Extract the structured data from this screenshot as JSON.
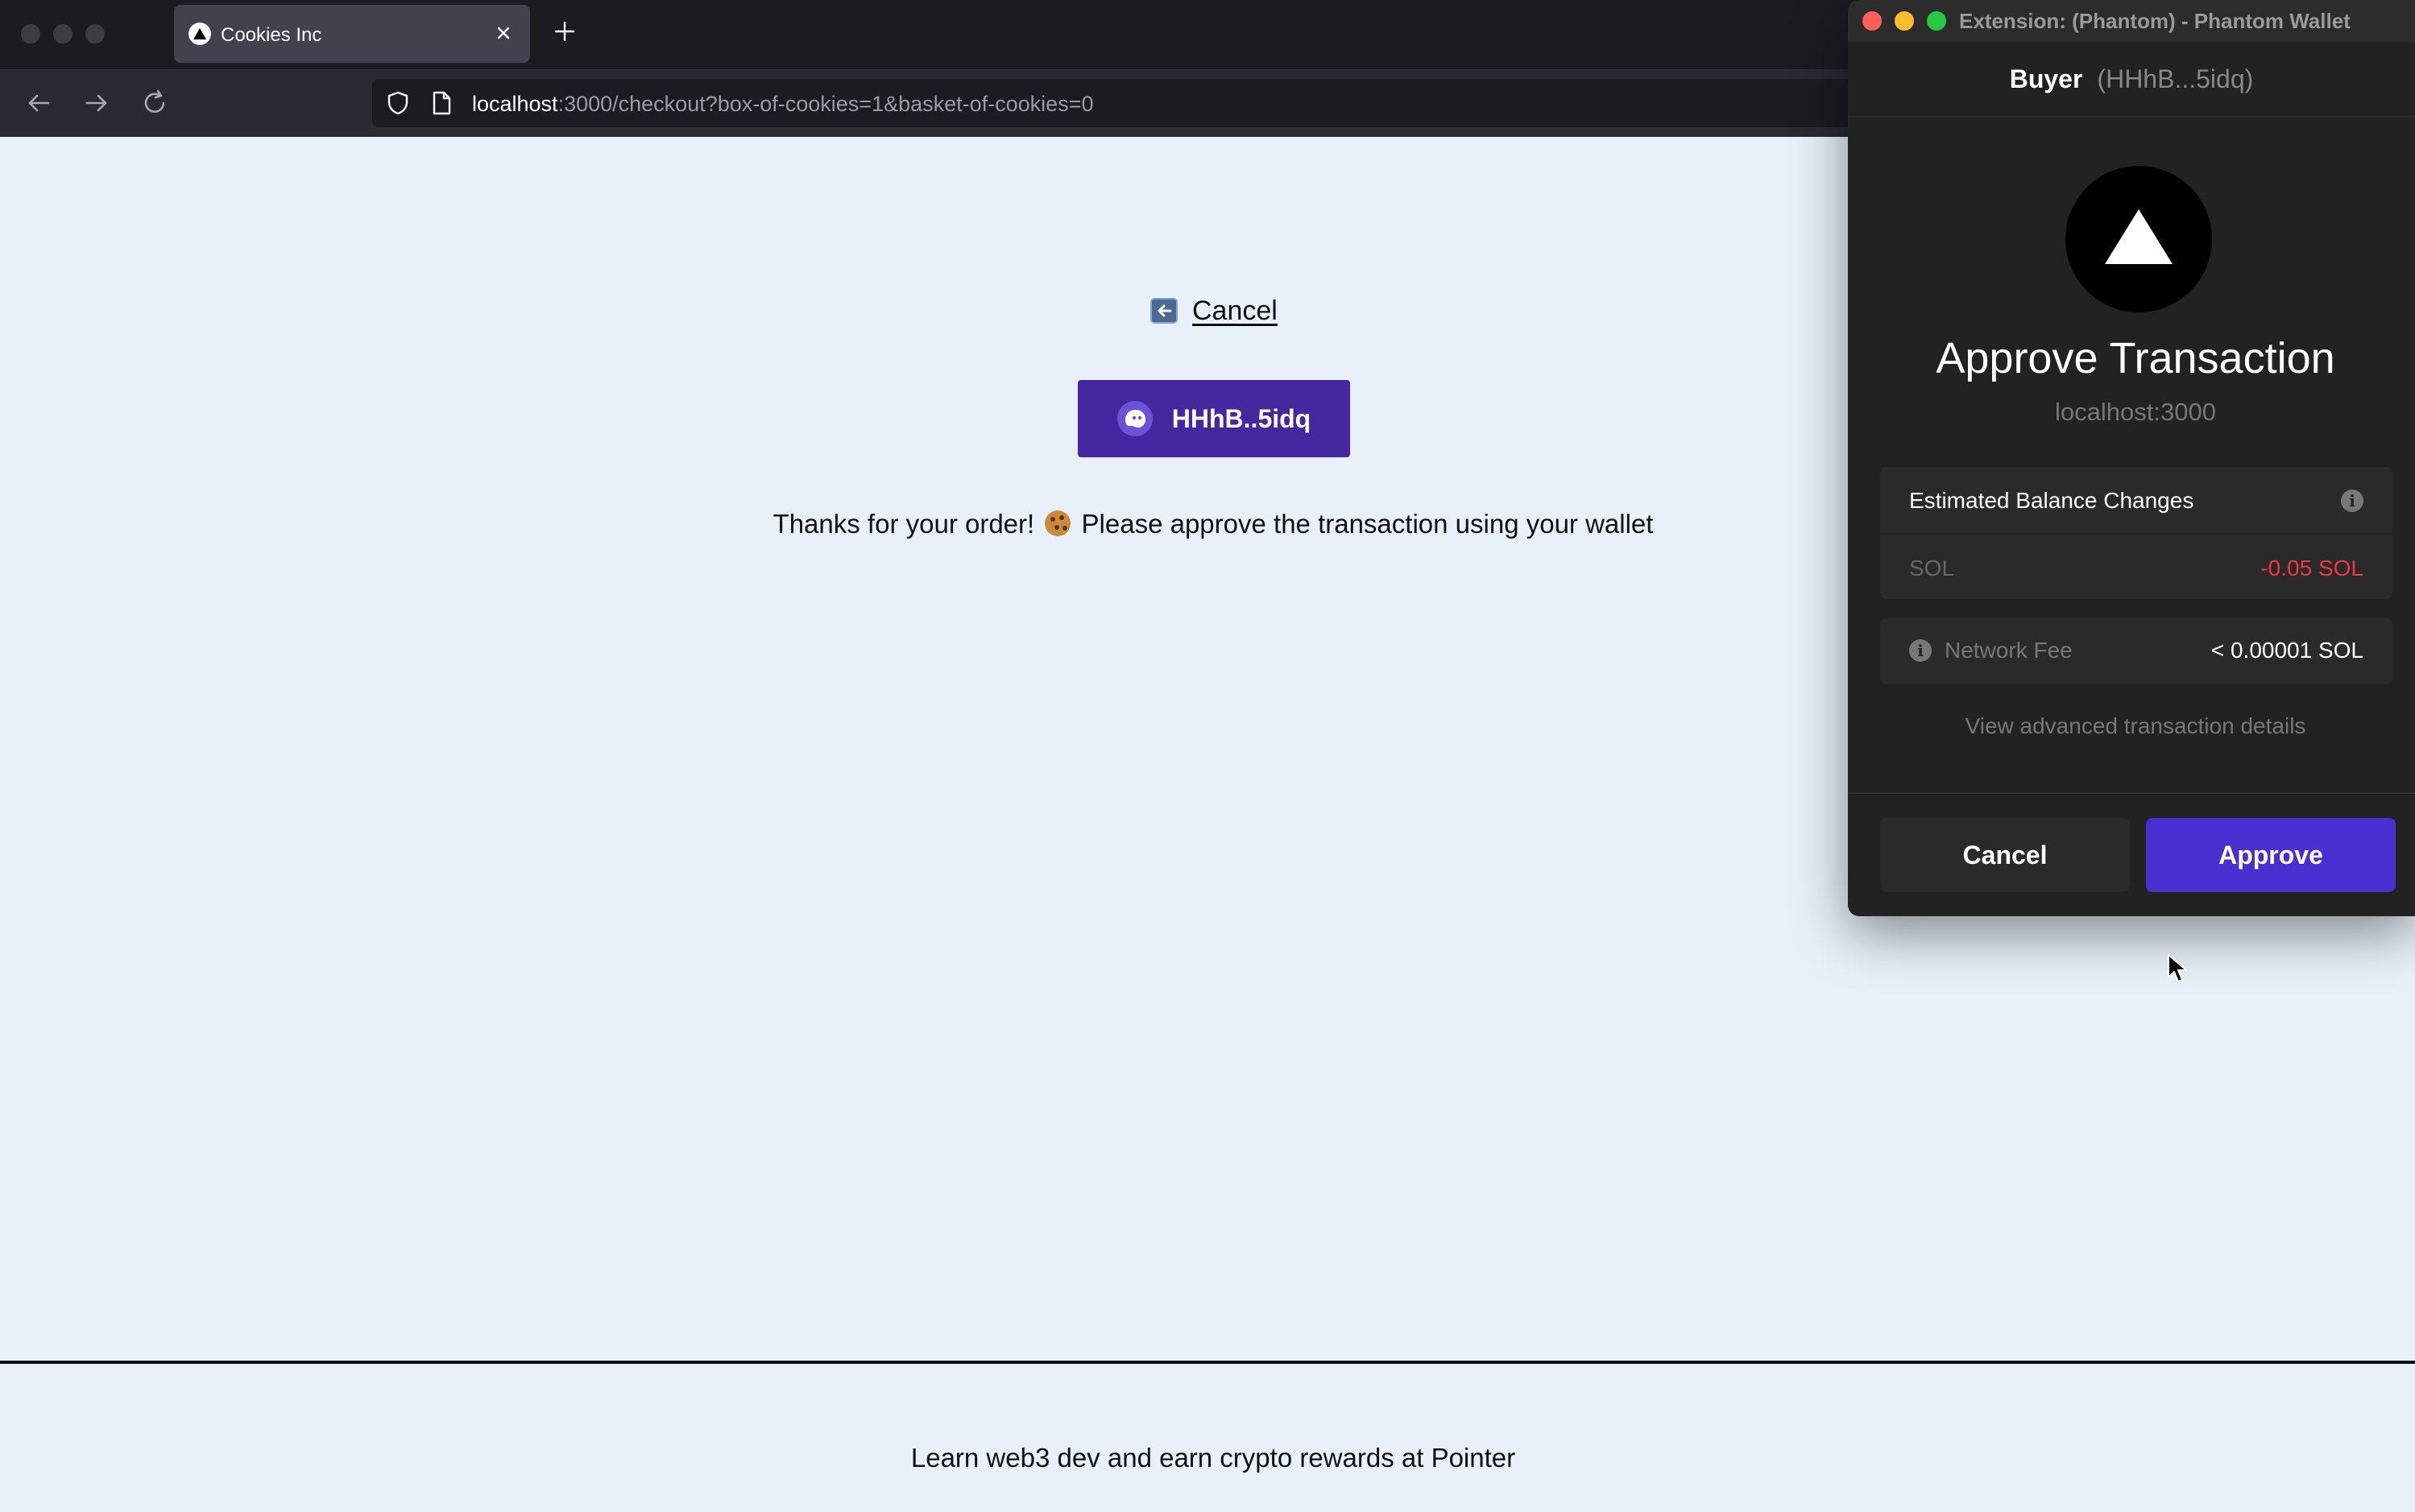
{
  "browser": {
    "tab_title": "Cookies Inc",
    "url_host": "localhost",
    "url_rest": ":3000/checkout?box-of-cookies=1&basket-of-cookies=0"
  },
  "page": {
    "cancel_label": "Cancel",
    "wallet_button_label": "HHhB..5idq",
    "thanks_before": "Thanks for your order!",
    "thanks_after": "Please approve the transaction using your wallet",
    "footer_text": "Learn web3 dev and earn crypto rewards at Pointer"
  },
  "popup": {
    "window_title": "Extension: (Phantom) - Phantom Wallet",
    "account_name": "Buyer",
    "account_address": "(HHhB...5idq)",
    "heading": "Approve Transaction",
    "origin": "localhost:3000",
    "balance_changes_title": "Estimated Balance Changes",
    "balance_token": "SOL",
    "balance_change": "-0.05 SOL",
    "network_fee_label": "Network Fee",
    "network_fee_value": "< 0.00001 SOL",
    "advanced_link": "View advanced transaction details",
    "cancel_button": "Cancel",
    "approve_button": "Approve"
  },
  "colors": {
    "page_background": "#e8f1fa",
    "wallet_button": "#4527a0",
    "approve_button": "#4a2fd0",
    "negative_change": "#eb3742"
  }
}
